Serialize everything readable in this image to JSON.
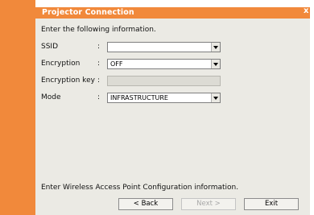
{
  "window": {
    "title": "Projector Connection",
    "close_icon": "close-icon"
  },
  "instruction": "Enter the following information.",
  "fields": [
    {
      "label": "SSID",
      "value": ""
    },
    {
      "label": "Encryption",
      "value": "OFF"
    },
    {
      "label": "Encryption key",
      "value": ""
    },
    {
      "label": "Mode",
      "value": "INFRASTRUCTURE"
    }
  ],
  "colon": ":",
  "footer_text": "Enter Wireless Access Point Configuration information.",
  "buttons": {
    "back": "< Back",
    "next": "Next >",
    "exit": "Exit"
  }
}
